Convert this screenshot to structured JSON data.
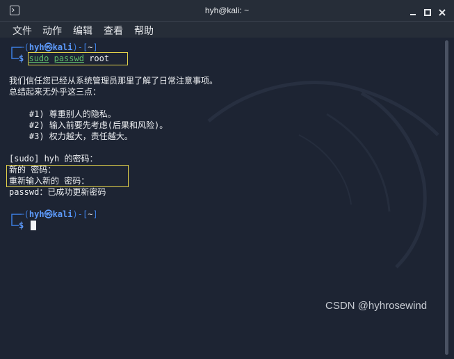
{
  "window": {
    "title": "hyh@kali: ~",
    "icons": [
      "terminal-icon",
      "minimize-icon",
      "maximize-icon",
      "close-icon"
    ]
  },
  "menu": {
    "items": [
      "文件",
      "动作",
      "编辑",
      "查看",
      "帮助"
    ]
  },
  "terminal": {
    "prompt1": {
      "user": "hyh",
      "at": "㉿",
      "host": "kali",
      "dir": "~",
      "dollar": "$"
    },
    "command": {
      "program": "sudo",
      "args": "passwd",
      "target": "root"
    },
    "lecture": [
      "我们信任您已经从系统管理员那里了解了日常注意事项。",
      "总结起来无外乎这三点：",
      "",
      "    #1) 尊重别人的隐私。",
      "    #2) 输入前要先考虑(后果和风险)。",
      "    #3) 权力越大，责任越大。"
    ],
    "sudo_prompt": "[sudo] hyh 的密码：",
    "new_password_prompt": "新的 密码：",
    "retype_prompt": "重新输入新的 密码：",
    "result": "passwd：已成功更新密码",
    "prompt2": {
      "user": "hyh",
      "at": "㉿",
      "host": "kali",
      "dir": "~",
      "dollar": "$"
    }
  },
  "watermark": "CSDN @hyhrosewind",
  "colors": {
    "titlebar": "#262d38",
    "terminal_bg": "#1d2433",
    "prompt_blue": "#3d7fe3",
    "command_green": "#61c06b",
    "highlight_box": "#e3d24a"
  }
}
